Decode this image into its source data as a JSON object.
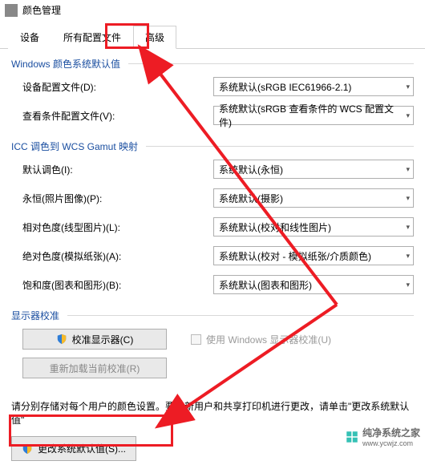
{
  "titlebar": {
    "title": "颜色管理"
  },
  "tabs": {
    "device": "设备",
    "all_profiles": "所有配置文件",
    "advanced": "高级"
  },
  "group_defaults": {
    "title": "Windows 颜色系统默认值",
    "device_profile_label": "设备配置文件(D):",
    "device_profile_value": "系统默认(sRGB IEC61966-2.1)",
    "viewing_profile_label": "查看条件配置文件(V):",
    "viewing_profile_value": "系统默认(sRGB 查看条件的 WCS 配置文件)"
  },
  "group_icc": {
    "title": "ICC 调色到 WCS Gamut 映射",
    "default_rendering_label": "默认调色(I):",
    "default_rendering_value": "系统默认(永恒)",
    "perceptual_label": "永恒(照片图像)(P):",
    "perceptual_value": "系统默认(摄影)",
    "relative_label": "相对色度(线型图片)(L):",
    "relative_value": "系统默认(校对和线性图片)",
    "absolute_label": "绝对色度(模拟纸张)(A):",
    "absolute_value": "系统默认(校对 - 模拟纸张/介质颜色)",
    "saturation_label": "饱和度(图表和图形)(B):",
    "saturation_value": "系统默认(图表和图形)"
  },
  "group_calibration": {
    "title": "显示器校准",
    "calibrate_btn": "校准显示器(C)",
    "use_win_calib": "使用 Windows 显示器校准(U)",
    "reload_btn": "重新加载当前校准(R)"
  },
  "instruction_text": "请分别存储对每个用户的颜色设置。要对新用户和共享打印机进行更改，请单击\"更改系统默认值\"",
  "change_defaults_btn": "更改系统默认值(S)...",
  "watermark": {
    "text": "纯净系统之家",
    "url": "www.ycwjz.com"
  }
}
